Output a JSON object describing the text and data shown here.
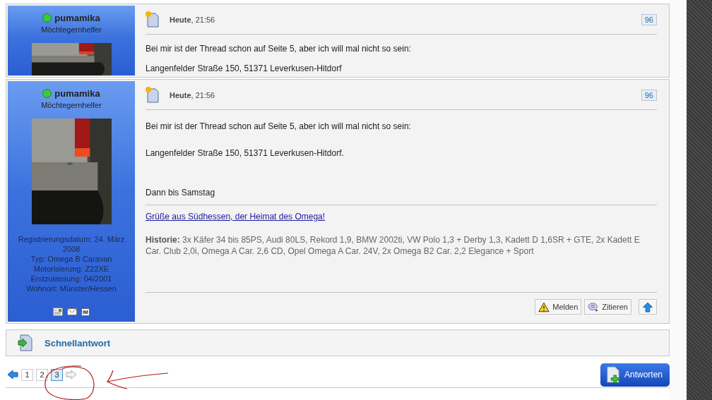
{
  "background_post": {
    "username": "pumamika",
    "rank": "Möchtegernhelfer",
    "online": true,
    "date": "**Heute**, 21:56",
    "post_number": "96",
    "lines": [
      "Bei mir ist der Thread schon auf Seite 5, aber ich will mal nicht so sein:",
      "Langenfelder Straße 150, 51371 Leverkusen-Hitdorf"
    ]
  },
  "post": {
    "username": "pumamika",
    "rank": "Möchtegernhelfer",
    "online": true,
    "profile": [
      "Registrierungsdatum: 24. März 2008",
      "Typ: Omega B Caravan",
      "Motorisierung: Z22XE",
      "Erstzulassung: 04/2001",
      "Wohnort: Münster/Hessen"
    ],
    "profile_icons": [
      {
        "kind": "profile"
      },
      {
        "kind": "email"
      },
      {
        "kind": "im",
        "label": "IM"
      }
    ],
    "date": "**Heute**, 21:56",
    "post_number": "96",
    "body": [
      "Bei mir ist der Thread schon auf Seite 5, aber ich will mal nicht so sein:",
      "Langenfelder Straße 150, 51371 Leverkusen-Hitdorf.",
      "Dann bis Samstag"
    ],
    "signature_link": "Grüße aus Südhessen, der Heimat des Omega!",
    "history": "**Historie:** 3x Käfer 34 bis 85PS, Audi 80LS, Rekord 1,9, BMW 2002ti, VW Polo 1,3 + Derby 1,3, Kadett D 1,6SR + GTE, 2x Kadett E Car. Club 2,0i, Omega A Car. 2,6 CD, Opel Omega A Car. 24V, 2x Omega B2 Car. 2,2 Elegance + Sport",
    "actions": [
      {
        "kind": "report",
        "label": "Melden"
      },
      {
        "kind": "quote",
        "label": "Zitieren"
      },
      {
        "kind": "top"
      }
    ]
  },
  "quick_reply": {
    "label": "Schnellantwort"
  },
  "pagination": {
    "pages": [
      {
        "label": "1",
        "selected": false
      },
      {
        "label": "2",
        "selected": false
      },
      {
        "label": "3",
        "selected": true
      }
    ]
  },
  "reply_button": {
    "label": "Antworten"
  }
}
